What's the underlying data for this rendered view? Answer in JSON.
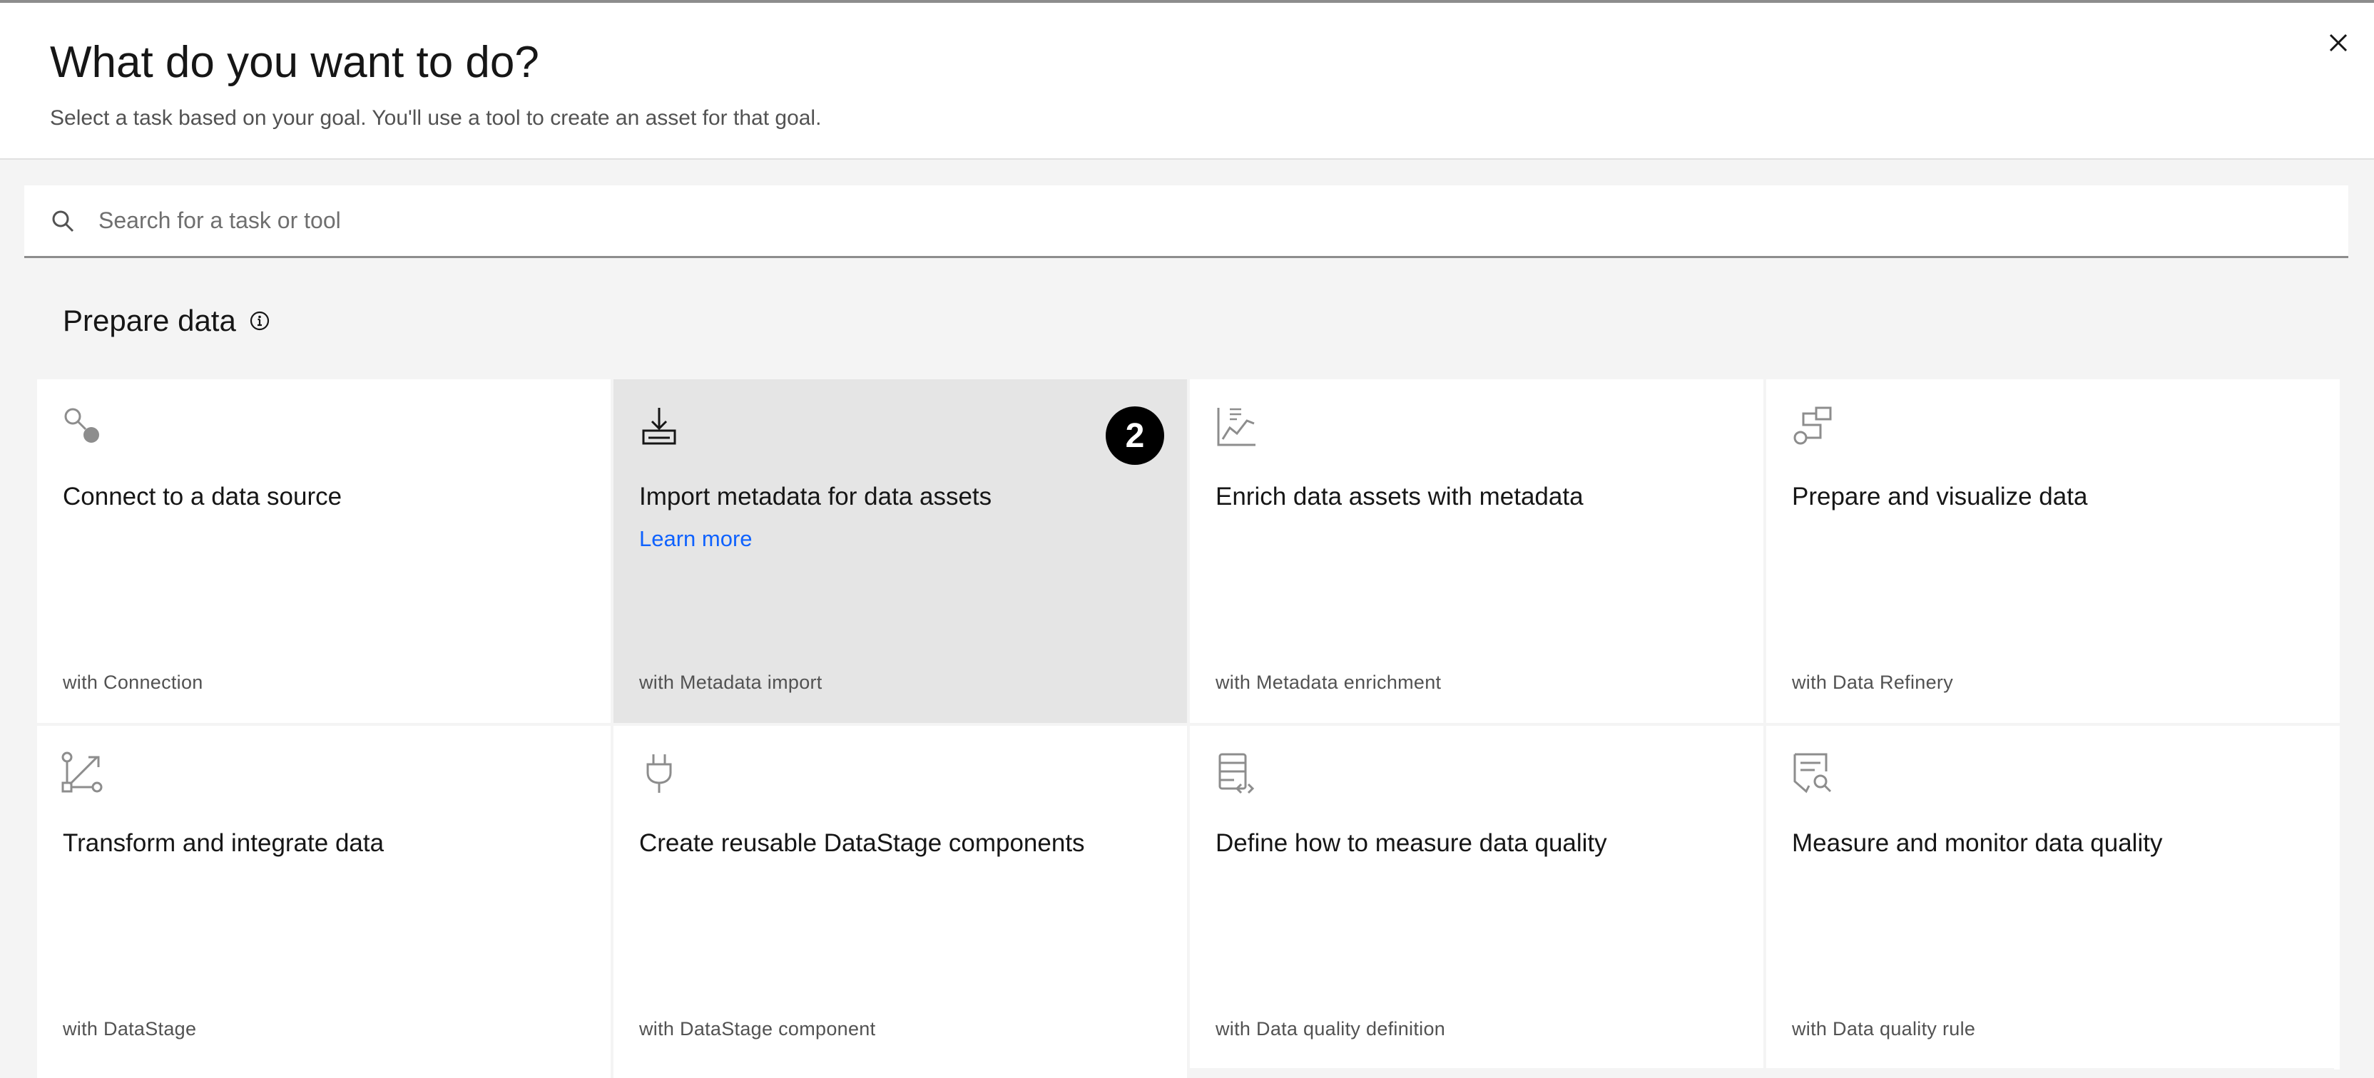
{
  "dialog": {
    "title": "What do you want to do?",
    "subtitle": "Select a task based on your goal. You'll use a tool to create an asset for that goal.",
    "close_icon": "close-icon"
  },
  "search": {
    "placeholder": "Search for a task or tool",
    "value": "",
    "icon": "search-icon"
  },
  "section": {
    "title": "Prepare data",
    "info_icon": "information-icon"
  },
  "tiles": [
    {
      "title": "Connect to a data source",
      "tool": "with Connection",
      "icon": "connect-icon",
      "selected": false
    },
    {
      "title": "Import metadata for data assets",
      "tool": "with Metadata import",
      "icon": "download-icon",
      "selected": true,
      "link": "Learn more",
      "badge": "2"
    },
    {
      "title": "Enrich data assets with metadata",
      "tool": "with Metadata enrichment",
      "icon": "chart-line-icon",
      "selected": false
    },
    {
      "title": "Prepare and visualize data",
      "tool": "with Data Refinery",
      "icon": "data-refinery-icon",
      "selected": false
    },
    {
      "title": "Transform and integrate data",
      "tool": "with DataStage",
      "icon": "flow-transform-icon",
      "selected": false
    },
    {
      "title": "Create reusable DataStage components",
      "tool": "with DataStage component",
      "icon": "plug-icon",
      "selected": false
    },
    {
      "title": "Define how to measure data quality",
      "tool": "with Data quality definition",
      "icon": "data-definition-icon",
      "selected": false
    },
    {
      "title": "Measure and monitor data quality",
      "tool": "with Data quality rule",
      "icon": "document-search-icon",
      "selected": false
    }
  ],
  "colors": {
    "link": "#0f62fe",
    "selected_tile": "#e5e5e5",
    "badge": "#000000"
  }
}
